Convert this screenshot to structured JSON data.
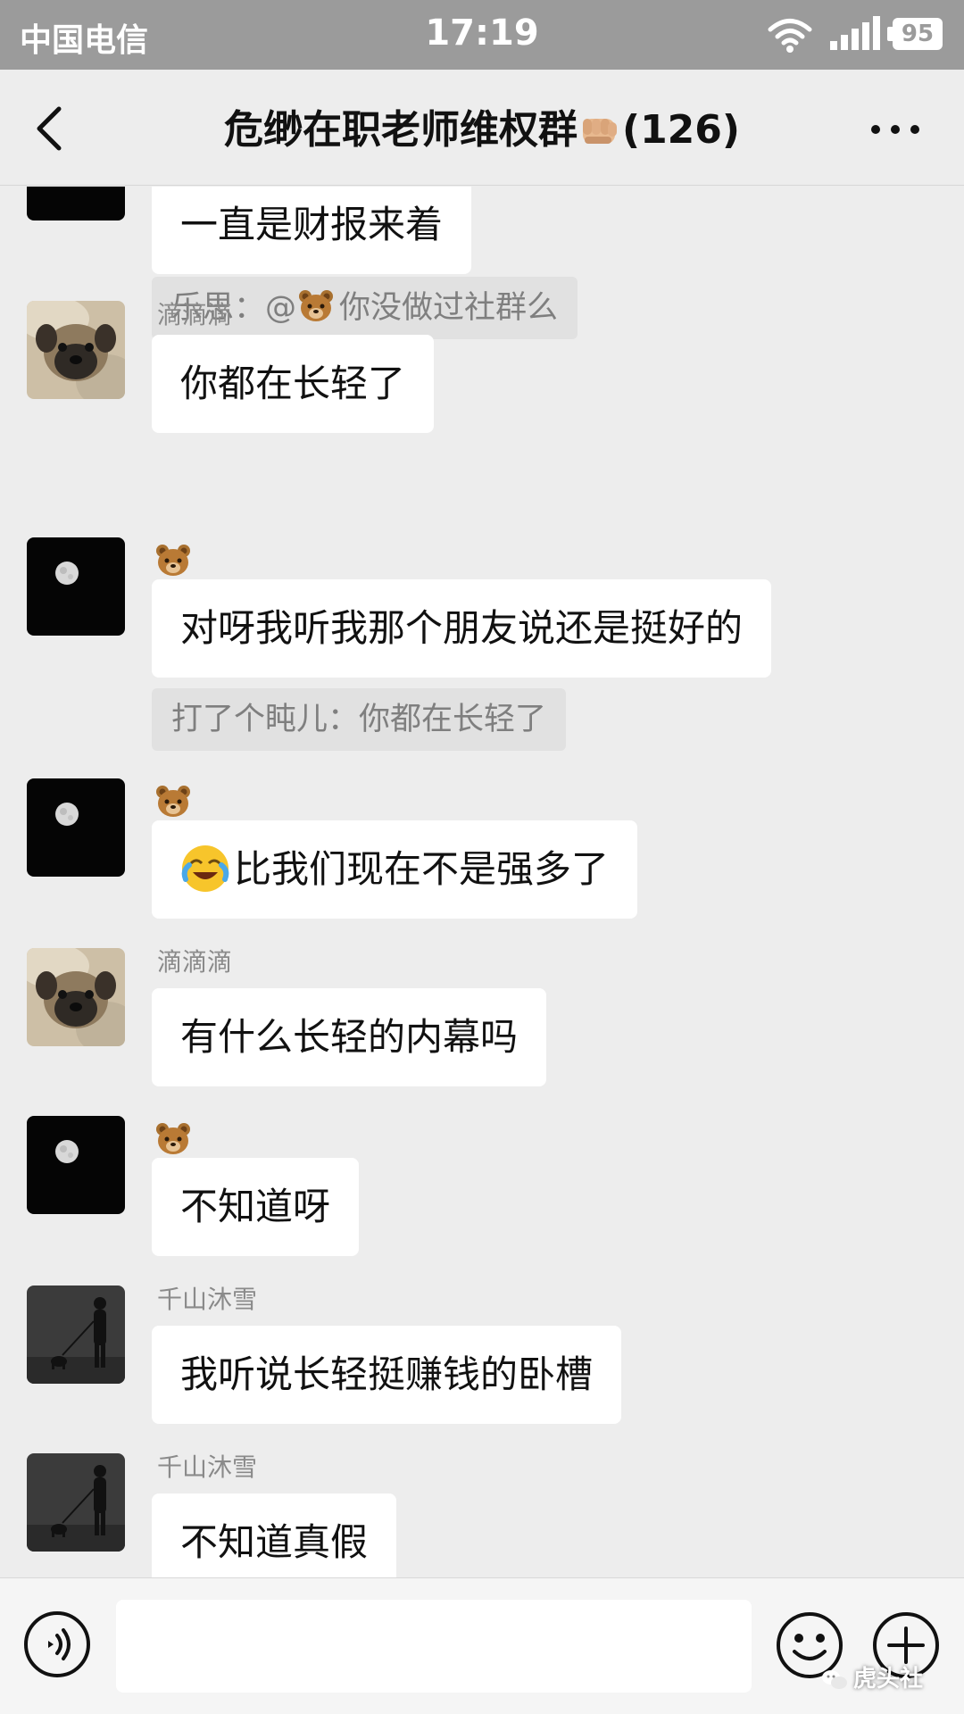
{
  "status_bar": {
    "carrier": "中国电信",
    "time": "17:19",
    "battery": "95"
  },
  "header": {
    "title": "危缈在职老师维权群",
    "member_count": "(126)"
  },
  "messages": [
    {
      "text": "一直是财报来着"
    },
    {
      "quote": {
        "prefix": "乐思：@",
        "text": "你没做过社群么"
      }
    },
    {
      "sender": "滴滴滴",
      "text": "你都在长轻了"
    },
    {
      "text": "对呀我听我那个朋友说还是挺好的"
    },
    {
      "quote": {
        "text": "打了个盹儿：你都在长轻了"
      }
    },
    {
      "text": "比我们现在不是强多了"
    },
    {
      "sender": "滴滴滴",
      "text": "有什么长轻的内幕吗"
    },
    {
      "text": "不知道呀"
    },
    {
      "sender": "千山沐雪",
      "text": "我听说长轻挺赚钱的卧槽"
    },
    {
      "sender": "千山沐雪",
      "text": "不知道真假"
    }
  ],
  "input_bar": {
    "placeholder": ""
  },
  "watermark": "虎头社",
  "colors": {
    "background": "#ededed",
    "bubble": "#ffffff",
    "quote": "#e1e1e1",
    "status_bar": "#9b9b9b"
  },
  "icons": [
    "back-arrow-icon",
    "fist-emoji-icon",
    "more-icon",
    "pug-avatar",
    "moon-avatar",
    "silhouette-avatar",
    "bear-emoji-icon",
    "crying-laughing-emoji-icon",
    "voice-icon",
    "emoji-icon",
    "plus-icon",
    "wechat-icon"
  ]
}
